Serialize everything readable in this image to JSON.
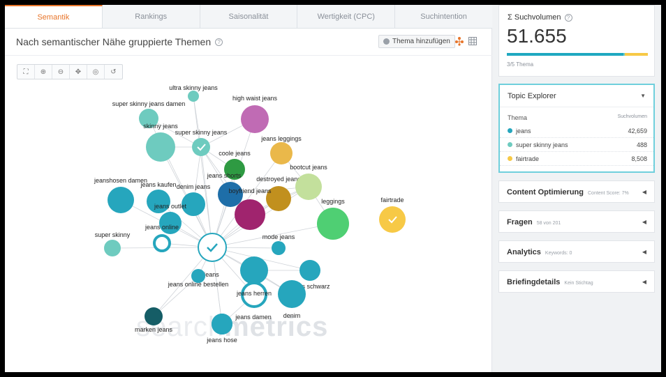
{
  "tabs": [
    {
      "label": "Semantik",
      "active": true
    },
    {
      "label": "Rankings"
    },
    {
      "label": "Saisonalität"
    },
    {
      "label": "Wertigkeit (CPC)"
    },
    {
      "label": "Suchintention"
    }
  ],
  "heading": "Nach semantischer Nähe gruppierte Themen",
  "add_topic_label": "Thema hinzufügen",
  "watermark": {
    "part1": "search",
    "part2": "metrics"
  },
  "colors": {
    "accent": "#e8752a",
    "teal": "#26a6bd",
    "lightteal": "#6ecbbf",
    "yellow": "#f7c946",
    "barcolor": "#1fa8c0"
  },
  "nodes": [
    {
      "label": "ultra skinny jeans",
      "color": "#6ecbbf"
    },
    {
      "label": "super skinny jeans damen",
      "color": "#6ecbbf"
    },
    {
      "label": "skinny jeans",
      "color": "#6ecbbf"
    },
    {
      "label": "super skinny jeans",
      "color": "#6ecbbf"
    },
    {
      "label": "high waist jeans",
      "color": "#c06bb4"
    },
    {
      "label": "coole jeans",
      "color": "#2e9a42"
    },
    {
      "label": "jeans leggings",
      "color": "#eab84a"
    },
    {
      "label": "jeans shorts",
      "color": "#1e6ea8"
    },
    {
      "label": "destroyed jeans",
      "color": "#c1901e"
    },
    {
      "label": "bootcut jeans",
      "color": "#c3e09c"
    },
    {
      "label": "boyfriend jeans",
      "color": "#a0246e"
    },
    {
      "label": "leggings",
      "color": "#4fcf73"
    },
    {
      "label": "fairtrade",
      "color": "#f7c946"
    },
    {
      "label": "jeanshosen damen",
      "color": "#26a6bd"
    },
    {
      "label": "jeans kaufen",
      "color": "#26a6bd"
    },
    {
      "label": "denim jeans",
      "color": "#26a6bd"
    },
    {
      "label": "jeans outlet",
      "color": "#26a6bd"
    },
    {
      "label": "jeans online",
      "color": "#26a6bd"
    },
    {
      "label": "super skinny",
      "color": "#6ecbbf"
    },
    {
      "label": "mode jeans",
      "color": "#26a6bd"
    },
    {
      "label": "jeans",
      "color": "#26a6bd"
    },
    {
      "label": "jeans online bestellen",
      "color": "#26a6bd"
    },
    {
      "label": "jeans herren",
      "color": "#26a6bd"
    },
    {
      "label": "jeans schwarz",
      "color": "#26a6bd"
    },
    {
      "label": "denim",
      "color": "#26a6bd"
    },
    {
      "label": "jeans damen",
      "color": "#26a6bd"
    },
    {
      "label": "marken jeans",
      "color": "#155d66"
    },
    {
      "label": "jeans hose",
      "color": "#26a6bd"
    }
  ],
  "suchvolumen": {
    "title": "Σ Suchvolumen",
    "value": "51.655",
    "themes_count": "3/5 Thema"
  },
  "topic_explorer": {
    "title": "Topic Explorer",
    "col_theme": "Thema",
    "col_volume": "Suchvolumen",
    "rows": [
      {
        "name": "jeans",
        "volume": "42,659",
        "color": "#26a6bd"
      },
      {
        "name": "super skinny jeans",
        "volume": "488",
        "color": "#6ecbbf"
      },
      {
        "name": "fairtrade",
        "volume": "8,508",
        "color": "#f7c946"
      }
    ]
  },
  "sections": [
    {
      "title": "Content Optimierung",
      "sub": "Content Score: 7%"
    },
    {
      "title": "Fragen",
      "sub": "58 von 201"
    },
    {
      "title": "Analytics",
      "sub": "Keywords: 0"
    },
    {
      "title": "Briefingdetails",
      "sub": "Kein Stichtag"
    }
  ]
}
